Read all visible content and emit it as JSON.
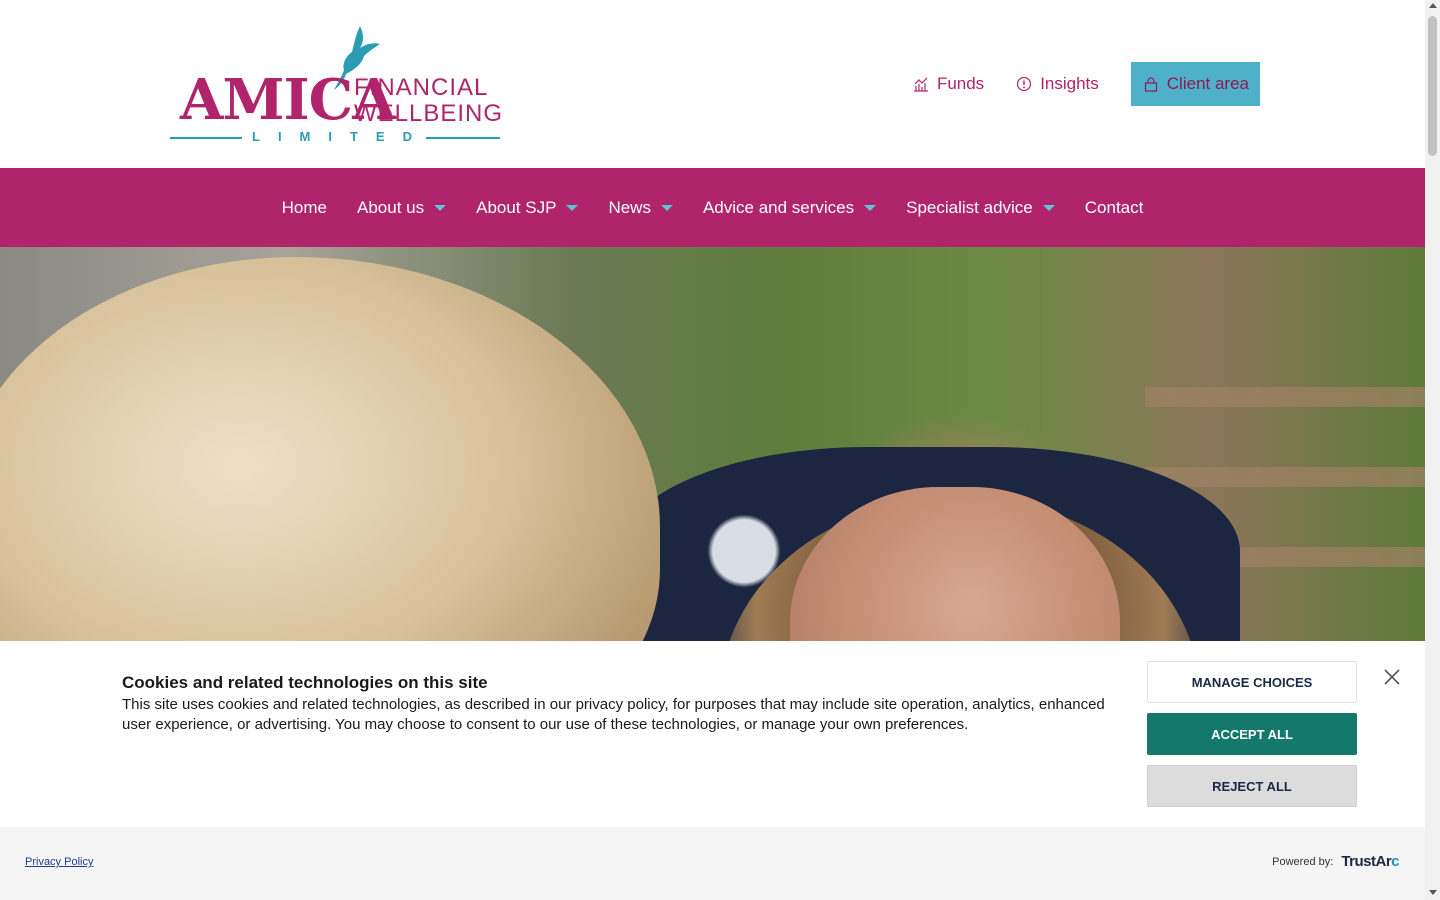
{
  "logo": {
    "brand": "AMICA",
    "line1": "FINANCIAL",
    "line2": "WELLBEING",
    "line3": "LIMITED",
    "bird_icon": "bird-icon",
    "colors": {
      "magenta": "#b0246c",
      "teal": "#2a9db5"
    }
  },
  "top_links": {
    "funds": {
      "label": "Funds",
      "icon": "chart-icon"
    },
    "insights": {
      "label": "Insights",
      "icon": "info-icon"
    },
    "client_area": {
      "label": "Client area",
      "icon": "lock-icon"
    }
  },
  "nav": {
    "items": [
      {
        "label": "Home",
        "dropdown": false
      },
      {
        "label": "About us",
        "dropdown": true
      },
      {
        "label": "About SJP",
        "dropdown": true
      },
      {
        "label": "News",
        "dropdown": true
      },
      {
        "label": "Advice and services",
        "dropdown": true
      },
      {
        "label": "Specialist advice",
        "dropdown": true
      },
      {
        "label": "Contact",
        "dropdown": false
      }
    ],
    "background": "#b0246c",
    "caret_color": "#5cc3d9"
  },
  "cookie": {
    "title": "Cookies and related technologies on this site",
    "text": "This site uses cookies and related technologies, as described in our privacy policy, for purposes that may include site operation, analytics, enhanced user experience, or advertising. You may choose to consent to our use of these technologies, or manage your own preferences.",
    "manage_label": "MANAGE CHOICES",
    "accept_label": "ACCEPT ALL",
    "reject_label": "REJECT ALL",
    "accept_color": "#14786b"
  },
  "footer": {
    "privacy_label": "Privacy Policy",
    "powered_label": "Powered by:",
    "brand_main": "TrustAr",
    "brand_accent": "c"
  }
}
